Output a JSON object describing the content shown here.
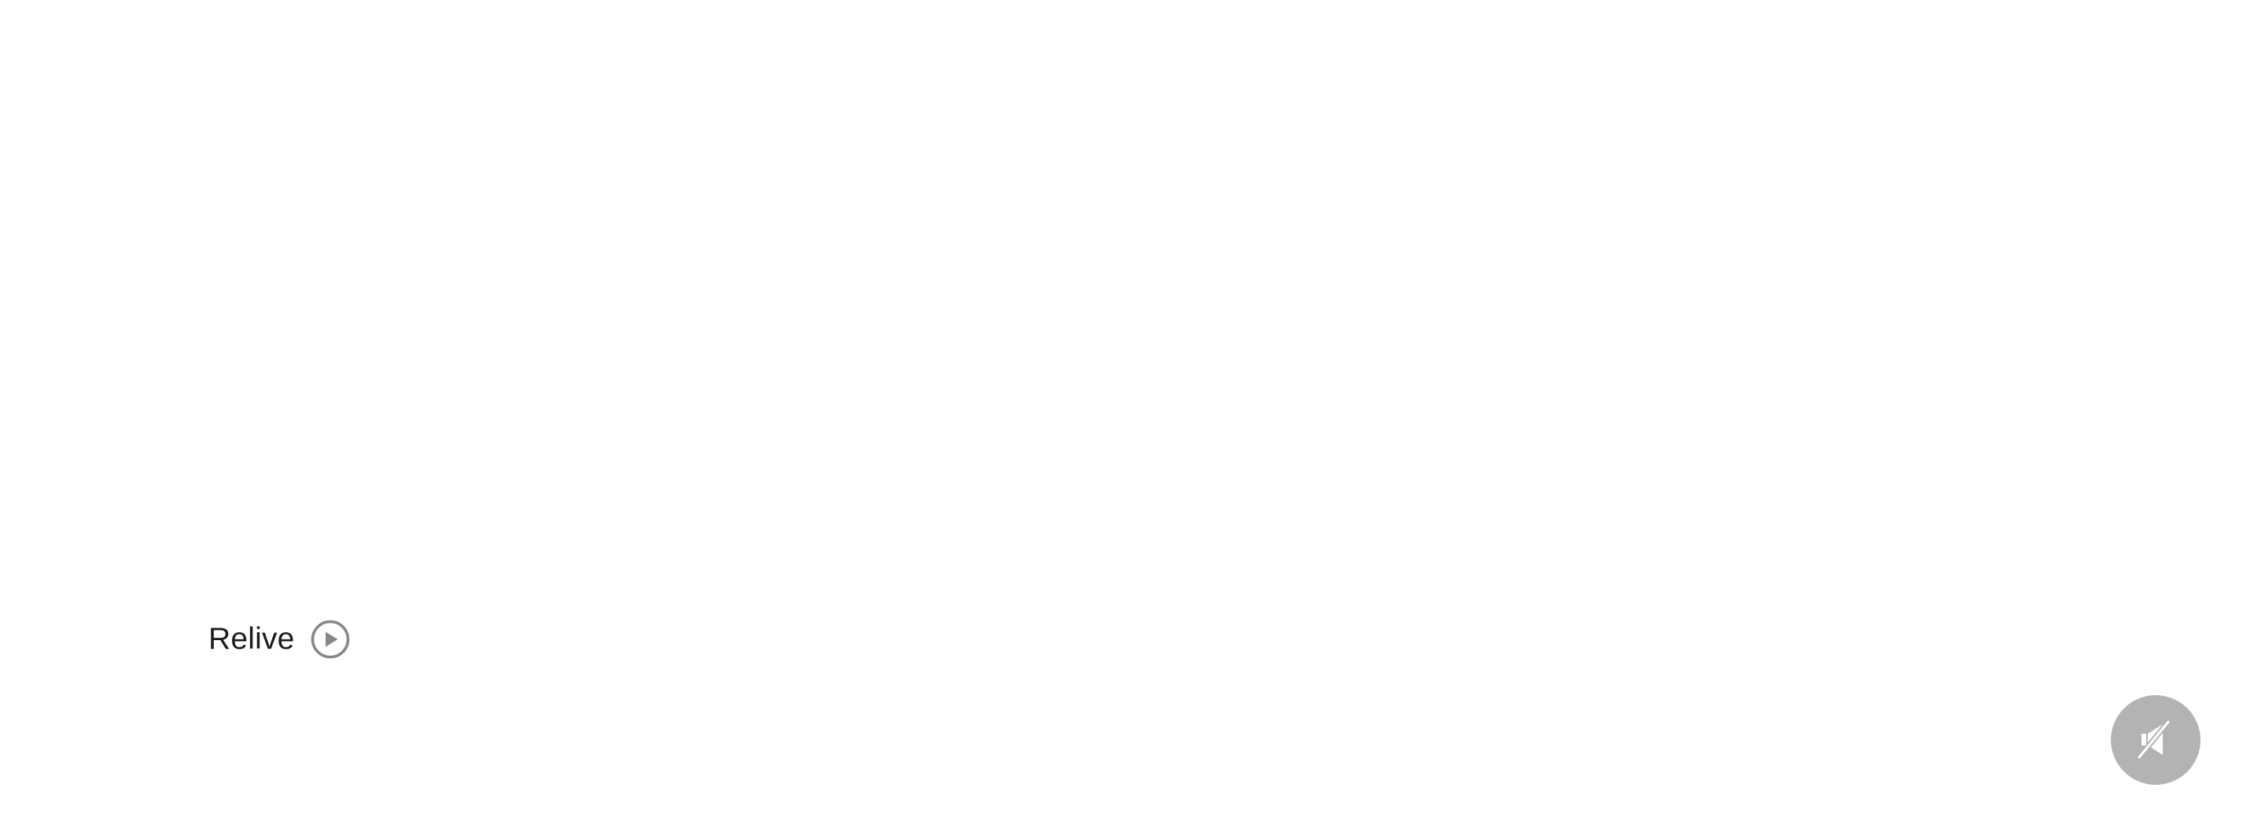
{
  "relive": {
    "label": "Relive",
    "icon": "play-circle-icon",
    "icon_color": "#86868b",
    "text_color": "#1d1d1f"
  },
  "audio_toggle": {
    "icon": "speaker-muted-icon",
    "state": "muted",
    "background_color": "#b3b3b3",
    "icon_color": "#ffffff"
  }
}
